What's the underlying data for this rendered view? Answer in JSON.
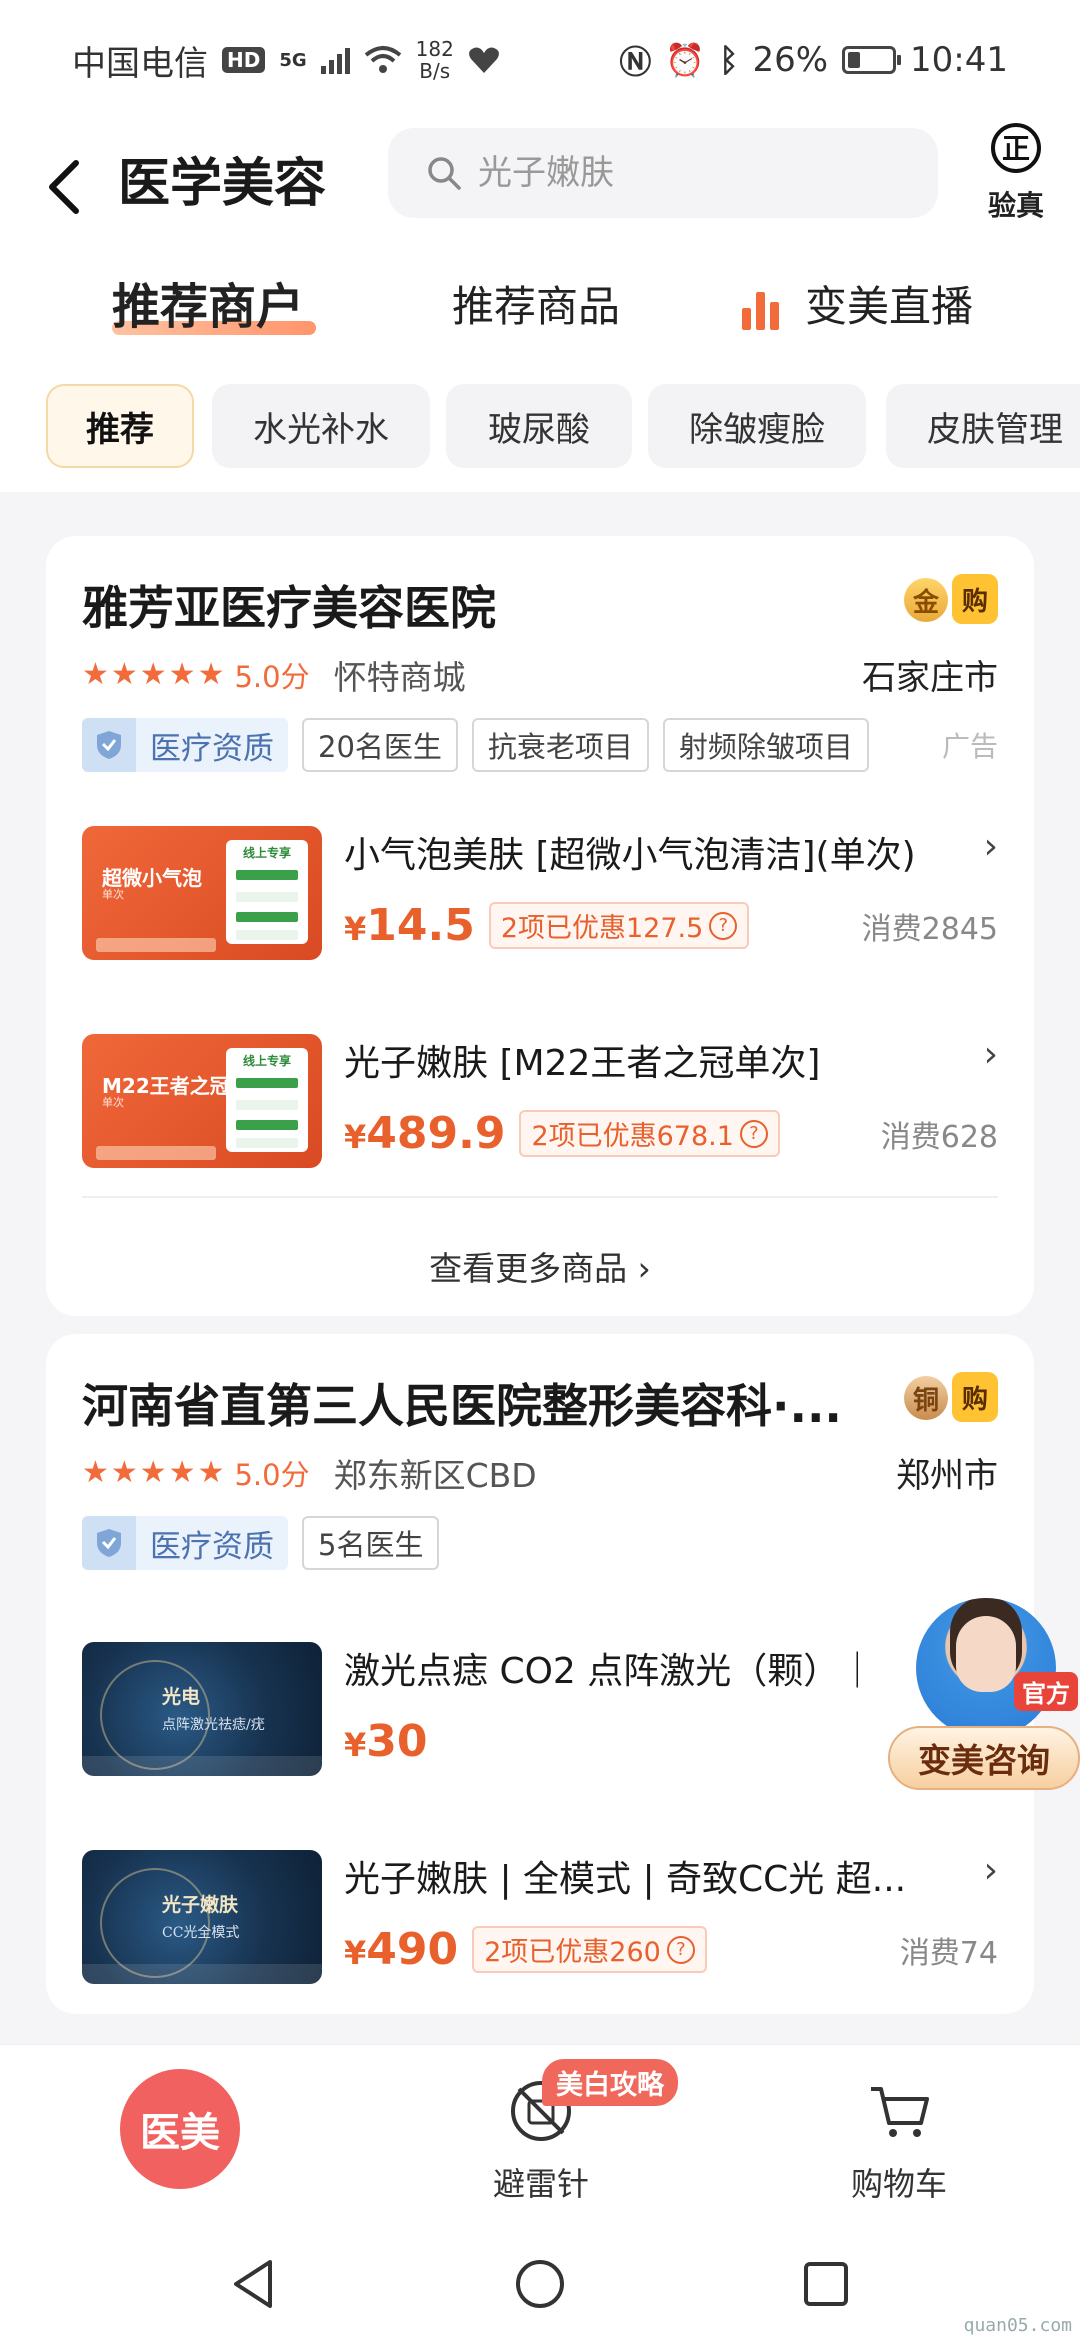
{
  "status_bar": {
    "carrier": "中国电信",
    "hd": "HD",
    "net": "5G",
    "speed_value": "182",
    "speed_unit": "B/s",
    "battery": "26%",
    "time": "10:41"
  },
  "header": {
    "title": "医学美容",
    "search_placeholder": "光子嫩肤",
    "verify_icon": "正",
    "verify_label": "验真"
  },
  "tabs": [
    {
      "label": "推荐商户",
      "active": true
    },
    {
      "label": "推荐商品",
      "active": false
    },
    {
      "label": "变美直播",
      "active": false
    }
  ],
  "chips": [
    "推荐",
    "水光补水",
    "玻尿酸",
    "除皱瘦脸",
    "皮肤管理"
  ],
  "merchants": [
    {
      "name": "雅芳亚医疗美容医院",
      "medal": "金",
      "buy_badge": "购",
      "stars": "★★★★★",
      "score": "5.0分",
      "area": "怀特商城",
      "city": "石家庄市",
      "qualification": "医疗资质",
      "tags": [
        "20名医生",
        "抗衰老项目",
        "射频除皱项目"
      ],
      "ad": "广告",
      "products": [
        {
          "title": "小气泡美肤 [超微小气泡清洁](单次)",
          "price": "14.5",
          "discount": "2项已优惠127.5",
          "sales": "消费2845",
          "thumb_title": "超微小气泡",
          "thumb_sub": "单次",
          "thumb_panel": "线上专享"
        },
        {
          "title": "光子嫩肤 [M22王者之冠单次]",
          "price": "489.9",
          "discount": "2项已优惠678.1",
          "sales": "消费628",
          "thumb_title": "M22王者之冠",
          "thumb_sub": "单次",
          "thumb_panel": "线上专享"
        }
      ],
      "more": "查看更多商品 ›"
    },
    {
      "name": "河南省直第三人民医院整形美容科·...",
      "medal": "铜",
      "buy_badge": "购",
      "stars": "★★★★★",
      "score": "5.0分",
      "area": "郑东新区CBD",
      "city": "郑州市",
      "qualification": "医疗资质",
      "tags": [
        "5名医生"
      ],
      "products": [
        {
          "title": "激光点痣 CO2  点阵激光（颗）｜",
          "price": "30",
          "thumb_title": "光电",
          "thumb_sub": "点阵激光祛痣/疣"
        },
        {
          "title": "光子嫩肤 | 全模式 | 奇致CC光 超...",
          "price": "490",
          "discount": "2项已优惠260",
          "sales": "消费74",
          "thumb_title": "光子嫩肤",
          "thumb_sub": "CC光全模式"
        }
      ]
    }
  ],
  "consult": {
    "official": "官方",
    "label": "变美咨询"
  },
  "bottom_nav": {
    "main": "医美",
    "badge": "美白攻略",
    "items": [
      {
        "label": "避雷针",
        "icon": "lightning-rod-icon"
      },
      {
        "label": "购物车",
        "icon": "cart-icon"
      }
    ]
  },
  "currency": "¥",
  "qmark": "?",
  "watermark": "quan05.com",
  "colors": {
    "accent": "#e8602c",
    "star": "#f26b3a",
    "main_button": "#f06160",
    "qualification": "#4c72b0"
  }
}
